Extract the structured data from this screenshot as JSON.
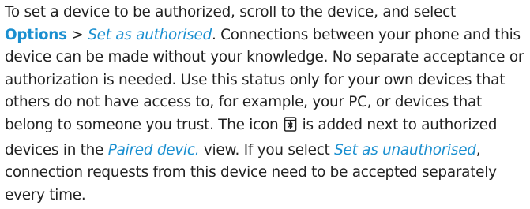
{
  "paragraph": {
    "l1": "To set a device to be authorized, scroll to the device, and select",
    "options_label": "Options",
    "sep": " > ",
    "set_auth_label": "Set as authorised",
    "l2_rest": ". Connections between your phone and this",
    "l3": "device can be made without your knowledge. No separate acceptance or",
    "l4": "authorization is needed. Use this status only for your own devices that",
    "l5": "others do not have access to, for example, your PC, or devices that",
    "l6_a": "belong to someone you trust. The icon ",
    "l6_b": " is added next to authorized",
    "l7_a": "devices in the ",
    "paired_label": "Paired devic.",
    "l7_b": " view. If you select ",
    "set_unauth_label": "Set as unauthorised",
    "l7_c": ",",
    "l8": "connection requests from this device need to be accepted separately",
    "l9": "every time."
  },
  "icons": {
    "authorized_device_icon": "authorized-device-icon"
  },
  "colors": {
    "text": "#222222",
    "link": "#1a8fd0"
  }
}
